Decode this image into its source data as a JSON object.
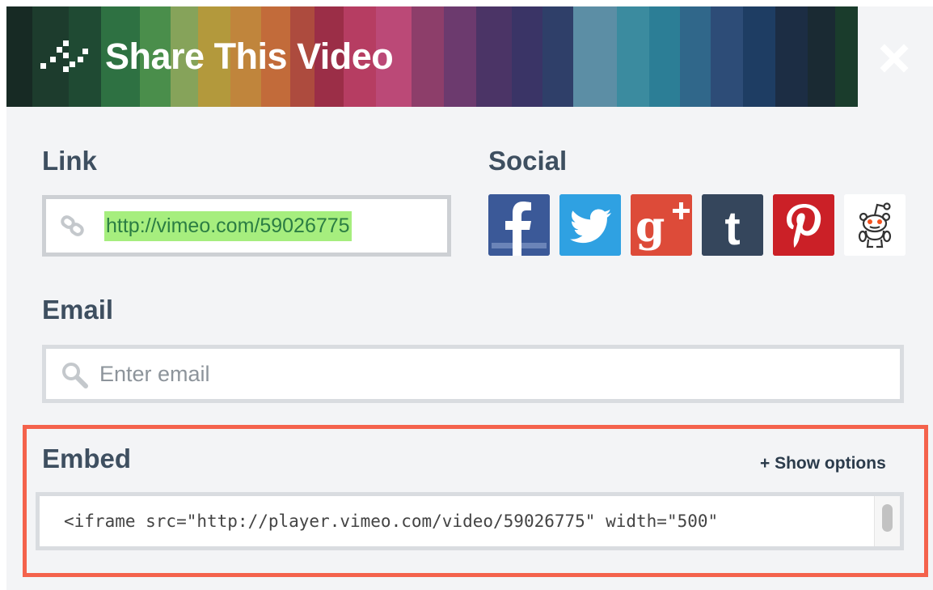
{
  "dialog": {
    "title": "Share This Video",
    "header_stripe_colors": [
      "#172a24",
      "#1d3c2d",
      "#1f4a33",
      "#2e7142",
      "#4a8e4b",
      "#86a35a",
      "#b3993c",
      "#c0853c",
      "#c26b3a",
      "#ad4b3e",
      "#9b2e47",
      "#b63d62",
      "#bb4977",
      "#8d3e6a",
      "#6c3a6e",
      "#4b3466",
      "#3a3466",
      "#2f3f69",
      "#5c8ea5",
      "#3b8b9f",
      "#2c7e96",
      "#30678a",
      "#2d4c77",
      "#1e3d63",
      "#1c2d44",
      "#1a2a33",
      "#1a3c2c"
    ],
    "close_icon": "close-icon"
  },
  "link": {
    "label": "Link",
    "value": "http://vimeo.com/59026775",
    "icon": "link-icon"
  },
  "social": {
    "label": "Social",
    "buttons": [
      {
        "name": "facebook",
        "icon": "facebook-icon",
        "color": "#3b5998"
      },
      {
        "name": "twitter",
        "icon": "twitter-icon",
        "color": "#2fa1e2"
      },
      {
        "name": "google-plus",
        "icon": "google-plus-icon",
        "color": "#dd4b39"
      },
      {
        "name": "tumblr",
        "icon": "tumblr-icon",
        "color": "#35465c"
      },
      {
        "name": "pinterest",
        "icon": "pinterest-icon",
        "color": "#cb2027"
      },
      {
        "name": "reddit",
        "icon": "reddit-icon",
        "color": "#ffffff"
      }
    ]
  },
  "email": {
    "label": "Email",
    "placeholder": "Enter email",
    "value": "",
    "icon": "search-icon"
  },
  "embed": {
    "label": "Embed",
    "show_options": "+ Show options",
    "code": "<iframe src=\"http://player.vimeo.com/video/59026775\" width=\"500\"",
    "highlight_color": "#f4624c"
  }
}
